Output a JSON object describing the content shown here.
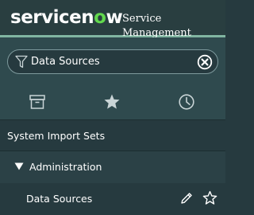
{
  "header": {
    "logo_prefix": "servicen",
    "logo_o": "o",
    "logo_suffix": "w",
    "app_name": "Service Management"
  },
  "filter": {
    "value": "Data Sources",
    "icon": "filter-icon",
    "clear_icon": "clear-icon"
  },
  "tabs": [
    {
      "icon": "archive-icon",
      "active": true
    },
    {
      "icon": "star-icon",
      "active": false
    },
    {
      "icon": "history-icon",
      "active": false
    }
  ],
  "nav": {
    "section": "System Import Sets",
    "group": "Administration",
    "module": "Data Sources"
  },
  "colors": {
    "background": "#263a3f",
    "header": "#293e40",
    "accent": "#81b5a1",
    "logo_o": "#62d84e"
  }
}
